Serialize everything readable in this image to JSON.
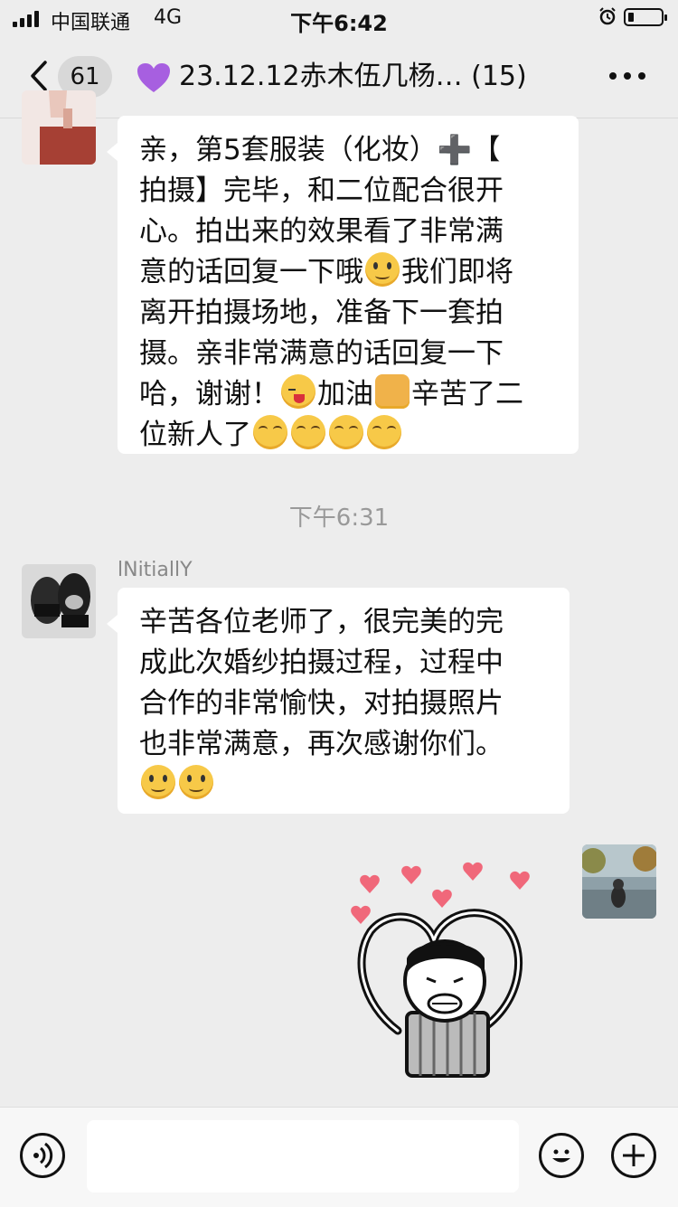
{
  "status_bar": {
    "carrier": "中国联通",
    "network": "4G",
    "time": "下午6:42"
  },
  "nav": {
    "unread_count": "61",
    "title": "23.12.12赤木伍几杨… (15)",
    "back_icon": "chevron-left-icon",
    "more_icon": "more-dots-icon"
  },
  "messages": {
    "first": {
      "lines": [
        "亲，第5套服装（化妆）",
        "拍摄】完毕，和二位配合很开",
        "心。拍出来的效果看了非常满",
        "意的话回复一下哦",
        "我们即将",
        "离开拍摄场地，准备下一套拍",
        "摄。亲非常满意的话回复一下",
        "哈，谢谢！",
        "加油",
        "辛苦了二",
        "位新人了"
      ],
      "plus_glyph": "➕",
      "bracket": "【"
    },
    "timestamp": "下午6:31",
    "second": {
      "sender": "lNitiallY",
      "lines": [
        "辛苦各位老师了，很完美的完",
        "成此次婚纱拍摄过程，过程中",
        "合作的非常愉快，对拍摄照片",
        "也非常满意，再次感谢你们。"
      ]
    }
  },
  "input_bar": {
    "voice_icon": "voice-icon",
    "emoji_icon": "emoji-icon",
    "plus_icon": "plus-icon"
  },
  "colors": {
    "background": "#ededed",
    "bubble": "#ffffff",
    "timestamp": "#999999"
  }
}
